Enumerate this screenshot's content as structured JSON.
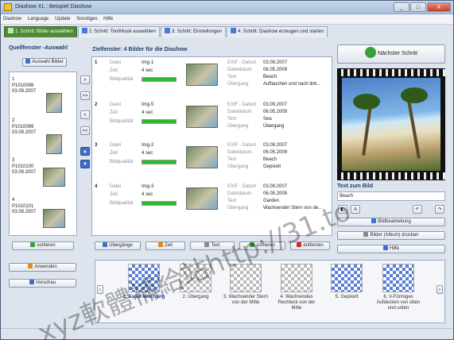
{
  "window": {
    "title": "Diashow XL : Beispiel Diashow",
    "controls": [
      "_",
      "□",
      "X"
    ]
  },
  "menu": [
    "Diashow",
    "Language",
    "Update",
    "Sonstiges",
    "Hilfe"
  ],
  "tabs": [
    {
      "label": "1. Schritt: Bilder auswählen",
      "active": true
    },
    {
      "label": "2. Schritt: Ton/Musik auswählen",
      "active": false
    },
    {
      "label": "3. Schritt: Einstellungen",
      "active": false
    },
    {
      "label": "4. Schritt: Diashow erzeugen und starten",
      "active": false
    }
  ],
  "source": {
    "title": "Quellfenster -Auswahl",
    "select_button": "Auswahl Bilder",
    "items": [
      {
        "num": "1",
        "file": "P1010098",
        "date": "03.09.2007"
      },
      {
        "num": "2",
        "file": "P1010099",
        "date": "03.09.2007"
      },
      {
        "num": "3",
        "file": "P1010100",
        "date": "03.09.2007"
      },
      {
        "num": "4",
        "file": "P1010101",
        "date": "03.09.2007"
      }
    ],
    "sort_button": "sortieren"
  },
  "arrows": [
    ">",
    ">>",
    "<",
    "<<",
    "▲",
    "▼"
  ],
  "target": {
    "title": "Zielfenster: 4 Bilder für die Diashow",
    "field_labels": {
      "file": "Datei",
      "time": "Zeit",
      "quality": "Bildqualität",
      "exif": "EXIF - Datum",
      "filedate": "Dateidatum",
      "text": "Text",
      "transition": "Übergang"
    },
    "rows": [
      {
        "num": "1",
        "file": "Img-1",
        "time": "4 sec",
        "quality": 1.0,
        "exif": "03.09.2007",
        "filedate": "06.05.2009",
        "text": "Beach",
        "transition": "Auftauchen und nach link..."
      },
      {
        "num": "2",
        "file": "Img-5",
        "time": "4 sec",
        "quality": 1.0,
        "exif": "03.09.2007",
        "filedate": "06.05.2009",
        "text": "Sea",
        "transition": "Übergang"
      },
      {
        "num": "3",
        "file": "Img-2",
        "time": "4 sec",
        "quality": 1.0,
        "exif": "03.09.2007",
        "filedate": "06.05.2009",
        "text": "Beach",
        "transition": "Gepixelt"
      },
      {
        "num": "4",
        "file": "Img-3",
        "time": "4 sec",
        "quality": 1.0,
        "exif": "03.09.2007",
        "filedate": "06.05.2009",
        "text": "Garden",
        "transition": "Wachsender Stern von de..."
      }
    ],
    "buttons": {
      "transitions": "Übergänge",
      "time": "Zeit",
      "text": "Text",
      "sort": "sortieren",
      "remove": "entfernen"
    }
  },
  "right": {
    "next_button": "Nächster Schritt",
    "text_title": "Text zum Bild",
    "text_value": "Beach",
    "edit_button": "Bildbearbeitung",
    "print_button": "Bilder (Album) drucken",
    "help_button": "Hilfe"
  },
  "bottom": {
    "apply_button": "Anwenden",
    "preview_button": "Vorschau",
    "transitions": [
      {
        "label": "1. Kanal Mischung",
        "selected": true
      },
      {
        "label": "2. Übergang",
        "selected": false
      },
      {
        "label": "3. Wachsender Stern von der Mitte",
        "selected": false
      },
      {
        "label": "4. Wachsendes Rechteck von der Mitte",
        "selected": false
      },
      {
        "label": "5. Gepixelt",
        "selected": false
      },
      {
        "label": "6. V-Förmiges Aufdecken von oben und unten",
        "selected": false
      }
    ]
  },
  "watermarks": [
    "xyz軟體補給站http://31.to"
  ],
  "colors": {
    "accent": "#4f8a36",
    "title_blue": "#1f3c72",
    "quality_bar": "#2dbb2d",
    "remove_red": "#d32c1f"
  }
}
